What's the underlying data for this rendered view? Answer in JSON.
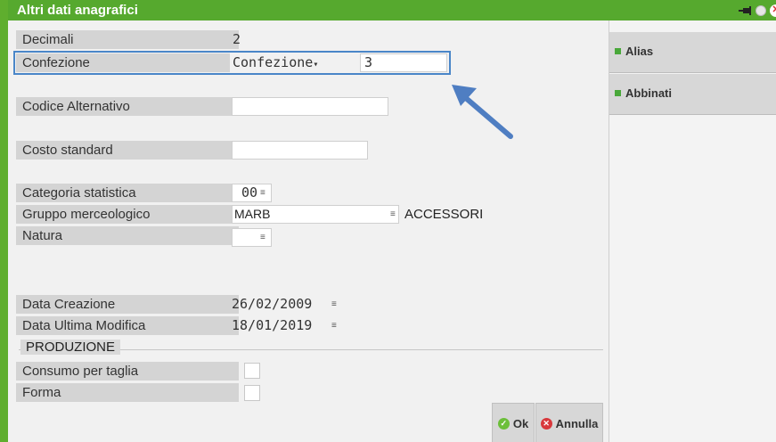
{
  "window": {
    "title": "Altri dati anagrafici"
  },
  "fields": {
    "decimali": {
      "label": "Decimali",
      "value": "2"
    },
    "confezione": {
      "label": "Confezione",
      "select_value": "Confezione",
      "qty_value": "3"
    },
    "codice_alternativo": {
      "label": "Codice Alternativo",
      "value": ""
    },
    "costo_standard": {
      "label": "Costo standard",
      "value": ""
    },
    "categoria_statistica": {
      "label": "Categoria statistica",
      "value": "00"
    },
    "gruppo_merceologico": {
      "label": "Gruppo merceologico",
      "value": "MARB",
      "description": "ACCESSORI"
    },
    "natura": {
      "label": "Natura",
      "value": ""
    },
    "data_creazione": {
      "label": "Data Creazione",
      "value": "26/02/2009"
    },
    "data_ultima_modifica": {
      "label": "Data Ultima Modifica",
      "value": "18/01/2019"
    }
  },
  "produzione": {
    "title": "PRODUZIONE",
    "consumo_per_taglia": {
      "label": "Consumo per taglia",
      "checked": false
    },
    "forma": {
      "label": "Forma",
      "checked": false
    }
  },
  "side_buttons": [
    {
      "label": "Alias"
    },
    {
      "label": "Abbinati"
    }
  ],
  "buttons": {
    "ok": "Ok",
    "annulla": "Annulla"
  },
  "icons": {
    "menu": "≡",
    "dropdown": "▾",
    "pin": "pin-icon",
    "status": "status-dot-icon",
    "close": "close-icon",
    "pointer_arrow": "arrow-pointer-icon"
  },
  "colors": {
    "titlebar": "#56a92e",
    "accent_green": "#49a83a",
    "arrow_blue": "#4f7ec2"
  }
}
